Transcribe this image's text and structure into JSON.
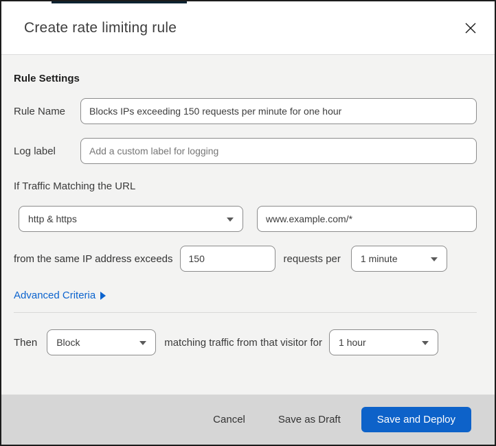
{
  "modal": {
    "title": "Create rate limiting rule"
  },
  "form": {
    "section_heading": "Rule Settings",
    "rule_name": {
      "label": "Rule Name",
      "value": "Blocks IPs exceeding 150 requests per minute for one hour"
    },
    "log_label": {
      "label": "Log label",
      "placeholder": "Add a custom label for logging"
    },
    "traffic_match": {
      "heading": "If Traffic Matching the URL",
      "scheme_selected": "http & https",
      "url_value": "www.example.com/*"
    },
    "threshold": {
      "prefix": "from the same IP address exceeds",
      "requests_value": "150",
      "middle": "requests per",
      "period_selected": "1 minute"
    },
    "advanced_link": "Advanced Criteria",
    "action": {
      "prefix": "Then",
      "action_selected": "Block",
      "middle": "matching traffic from that visitor for",
      "duration_selected": "1 hour"
    }
  },
  "footer": {
    "cancel_label": "Cancel",
    "save_draft_label": "Save as Draft",
    "save_deploy_label": "Save and Deploy"
  },
  "colors": {
    "primary_button": "#0d62c9",
    "link_blue": "#0b63ce",
    "body_background": "#f3f3f2",
    "footer_background": "#d6d6d6",
    "top_behind_bar": "#0c2433"
  }
}
